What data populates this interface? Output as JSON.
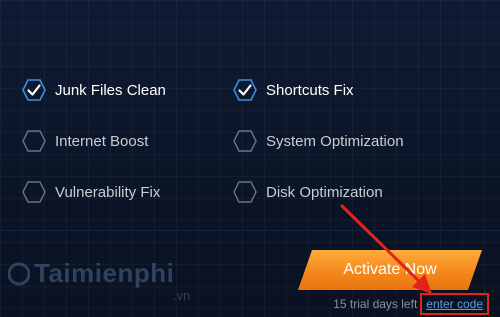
{
  "features": [
    {
      "label": "Junk Files Clean",
      "checked": true
    },
    {
      "label": "Shortcuts Fix",
      "checked": true
    },
    {
      "label": "Internet Boost",
      "checked": false
    },
    {
      "label": "System Optimization",
      "checked": false
    },
    {
      "label": "Vulnerability Fix",
      "checked": false
    },
    {
      "label": "Disk Optimization",
      "checked": false
    }
  ],
  "activate": {
    "label": "Activate Now"
  },
  "trial": {
    "text": "15 trial days left",
    "enter_code_label": "enter code"
  },
  "watermark": {
    "brand": "Taimienphi",
    "suffix": ".vn"
  },
  "colors": {
    "accent_orange": "#f5891d",
    "check_blue": "#3d8fe0",
    "highlight_red": "#e2231a",
    "link_blue": "#5a9fe6"
  }
}
